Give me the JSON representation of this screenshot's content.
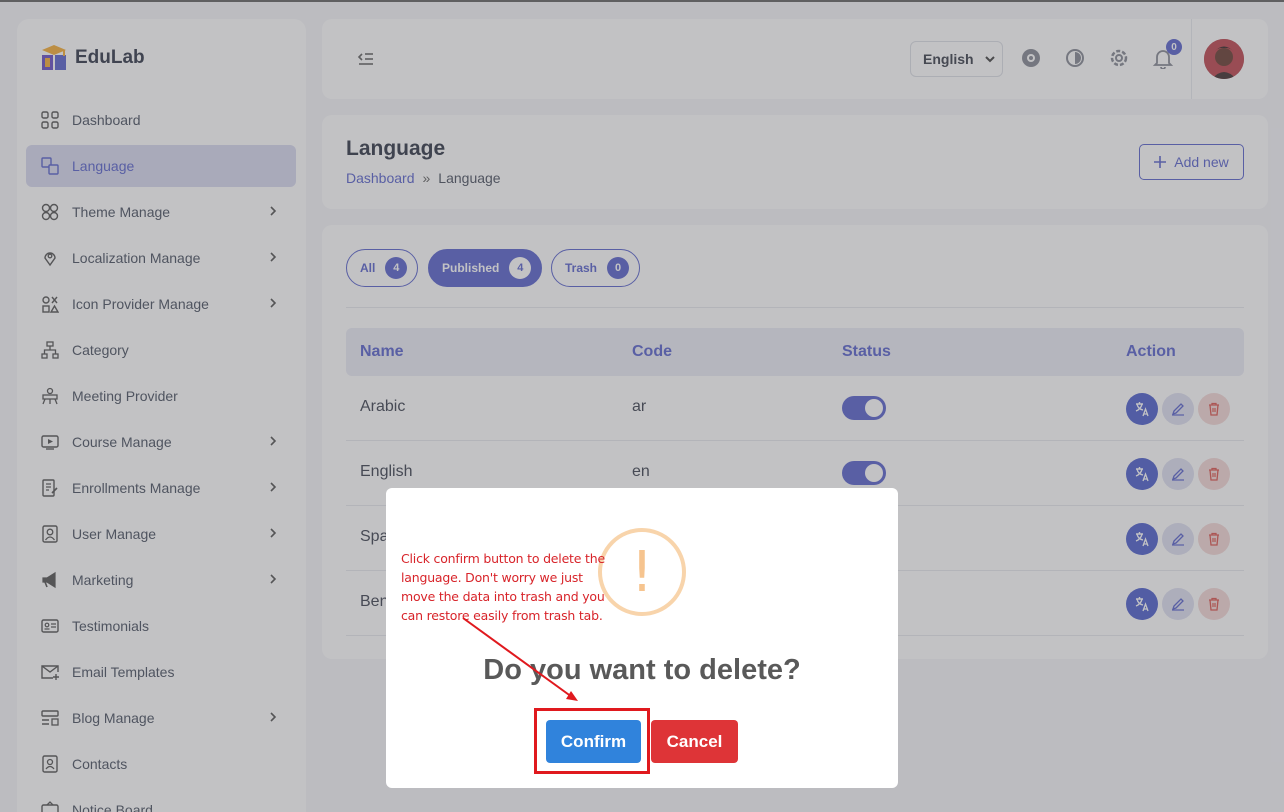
{
  "brand": {
    "name": "EduLab"
  },
  "sidebar": {
    "items": [
      {
        "label": "Dashboard",
        "icon": "grid-icon",
        "chevron": false,
        "active": false
      },
      {
        "label": "Language",
        "icon": "translate-icon",
        "chevron": false,
        "active": true
      },
      {
        "label": "Theme Manage",
        "icon": "flower-icon",
        "chevron": true,
        "active": false
      },
      {
        "label": "Localization Manage",
        "icon": "map-pin-icon",
        "chevron": true,
        "active": false
      },
      {
        "label": "Icon Provider Manage",
        "icon": "shapes-icon",
        "chevron": true,
        "active": false
      },
      {
        "label": "Category",
        "icon": "hierarchy-icon",
        "chevron": false,
        "active": false
      },
      {
        "label": "Meeting Provider",
        "icon": "meeting-icon",
        "chevron": false,
        "active": false
      },
      {
        "label": "Course Manage",
        "icon": "video-icon",
        "chevron": true,
        "active": false
      },
      {
        "label": "Enrollments Manage",
        "icon": "document-edit-icon",
        "chevron": true,
        "active": false
      },
      {
        "label": "User Manage",
        "icon": "user-icon",
        "chevron": true,
        "active": false
      },
      {
        "label": "Marketing",
        "icon": "megaphone-icon",
        "chevron": true,
        "active": false
      },
      {
        "label": "Testimonials",
        "icon": "id-card-icon",
        "chevron": false,
        "active": false
      },
      {
        "label": "Email Templates",
        "icon": "mail-plus-icon",
        "chevron": false,
        "active": false
      },
      {
        "label": "Blog Manage",
        "icon": "list-icon",
        "chevron": true,
        "active": false
      },
      {
        "label": "Contacts",
        "icon": "contact-icon",
        "chevron": false,
        "active": false
      },
      {
        "label": "Notice Board",
        "icon": "board-icon",
        "chevron": false,
        "active": false
      }
    ]
  },
  "topbar": {
    "language": "English",
    "notification_count": "0"
  },
  "header": {
    "title": "Language",
    "breadcrumb_home": "Dashboard",
    "breadcrumb_sep": "»",
    "breadcrumb_current": "Language",
    "add_label": "Add new"
  },
  "tabs": [
    {
      "label": "All",
      "count": "4"
    },
    {
      "label": "Published",
      "count": "4"
    },
    {
      "label": "Trash",
      "count": "0"
    }
  ],
  "table": {
    "columns": [
      "Name",
      "Code",
      "Status",
      "Action"
    ],
    "rows": [
      {
        "name": "Arabic",
        "code": "ar"
      },
      {
        "name": "English",
        "code": "en"
      },
      {
        "name": "Spa",
        "code": ""
      },
      {
        "name": "Ben",
        "code": ""
      }
    ]
  },
  "modal": {
    "icon_glyph": "!",
    "title": "Do you want to delete?",
    "confirm_label": "Confirm",
    "cancel_label": "Cancel"
  },
  "annotation": {
    "text": "Click confirm button to delete the language. Don't worry we just move the data into trash and you can restore easily from trash tab."
  },
  "colors": {
    "accent": "#4a55c9",
    "confirm": "#3083dc",
    "cancel": "#de3437",
    "annotation": "#e0191e"
  }
}
